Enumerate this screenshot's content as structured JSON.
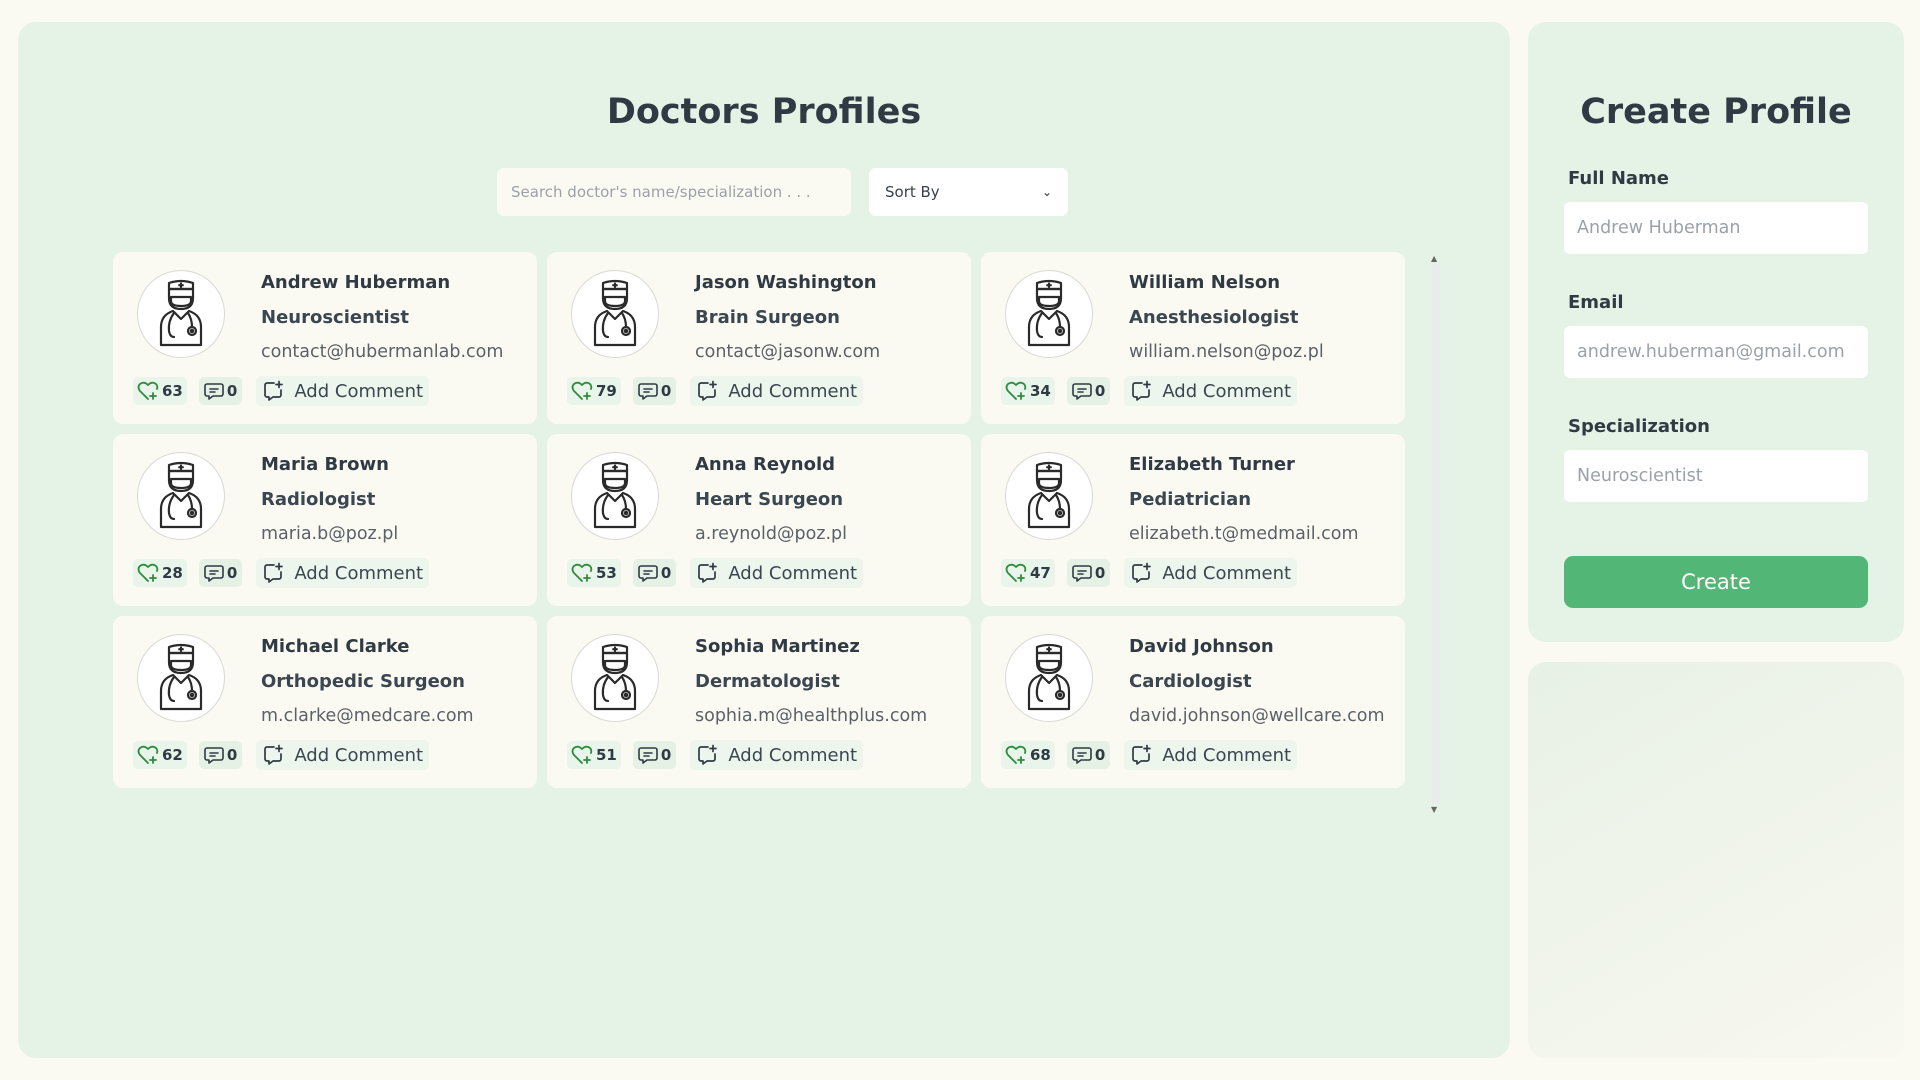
{
  "main": {
    "title": "Doctors Profiles",
    "search_placeholder": "Search doctor's name/specialization . . .",
    "sort_label": "Sort By",
    "add_comment_label": "Add Comment",
    "doctors": [
      {
        "name": "Andrew Huberman",
        "specialization": "Neuroscientist",
        "email": "contact@hubermanlab.com",
        "likes": "63",
        "comments": "0"
      },
      {
        "name": "Jason Washington",
        "specialization": "Brain Surgeon",
        "email": "contact@jasonw.com",
        "likes": "79",
        "comments": "0"
      },
      {
        "name": "William Nelson",
        "specialization": "Anesthesiologist",
        "email": "william.nelson@poz.pl",
        "likes": "34",
        "comments": "0"
      },
      {
        "name": "Maria Brown",
        "specialization": "Radiologist",
        "email": "maria.b@poz.pl",
        "likes": "28",
        "comments": "0"
      },
      {
        "name": "Anna Reynold",
        "specialization": "Heart Surgeon",
        "email": "a.reynold@poz.pl",
        "likes": "53",
        "comments": "0"
      },
      {
        "name": "Elizabeth Turner",
        "specialization": "Pediatrician",
        "email": "elizabeth.t@medmail.com",
        "likes": "47",
        "comments": "0"
      },
      {
        "name": "Michael Clarke",
        "specialization": "Orthopedic Surgeon",
        "email": "m.clarke@medcare.com",
        "likes": "62",
        "comments": "0"
      },
      {
        "name": "Sophia Martinez",
        "specialization": "Dermatologist",
        "email": "sophia.m@healthplus.com",
        "likes": "51",
        "comments": "0"
      },
      {
        "name": "David Johnson",
        "specialization": "Cardiologist",
        "email": "david.johnson@wellcare.com",
        "likes": "68",
        "comments": "0"
      }
    ]
  },
  "sidebar": {
    "title": "Create Profile",
    "full_name_label": "Full Name",
    "full_name_placeholder": "Andrew Huberman",
    "email_label": "Email",
    "email_placeholder": "andrew.huberman@gmail.com",
    "specialization_label": "Specialization",
    "specialization_placeholder": "Neuroscientist",
    "create_label": "Create"
  },
  "colors": {
    "panel": "#e4f3e5",
    "card": "#fbfaf2",
    "accent": "#52b776",
    "like_icon": "#2e8b3e"
  },
  "icons": {
    "avatar": "doctor-icon",
    "likes": "heart-plus-icon",
    "comments": "comment-icon",
    "add_comment": "add-comment-icon",
    "sort": "chevron-down-icon"
  }
}
